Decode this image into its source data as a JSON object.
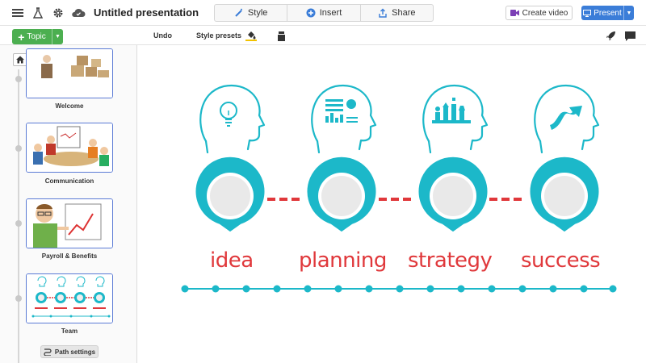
{
  "toolbar": {
    "title": "Untitled presentation",
    "tabs": [
      {
        "label": "Style",
        "icon": "wand-icon"
      },
      {
        "label": "Insert",
        "icon": "plus-circle-icon"
      },
      {
        "label": "Share",
        "icon": "share-icon"
      }
    ],
    "create_video": "Create video",
    "present": "Present"
  },
  "subbar": {
    "topic": "Topic",
    "undo": "Undo",
    "style_presets": "Style presets"
  },
  "sidebar": {
    "items": [
      {
        "label": "Welcome"
      },
      {
        "label": "Communication"
      },
      {
        "label": "Payroll & Benefits"
      },
      {
        "label": "Team"
      }
    ],
    "path_settings": "Path settings"
  },
  "slide": {
    "steps": [
      {
        "word": "idea",
        "icon": "lightbulb-head-icon"
      },
      {
        "word": "planning",
        "icon": "chart-head-icon"
      },
      {
        "word": "strategy",
        "icon": "chess-head-icon"
      },
      {
        "word": "success",
        "icon": "arrow-head-icon"
      }
    ],
    "colors": {
      "teal": "#1cb8c9",
      "red": "#e0383b",
      "grey": "#e9e9e9"
    }
  }
}
